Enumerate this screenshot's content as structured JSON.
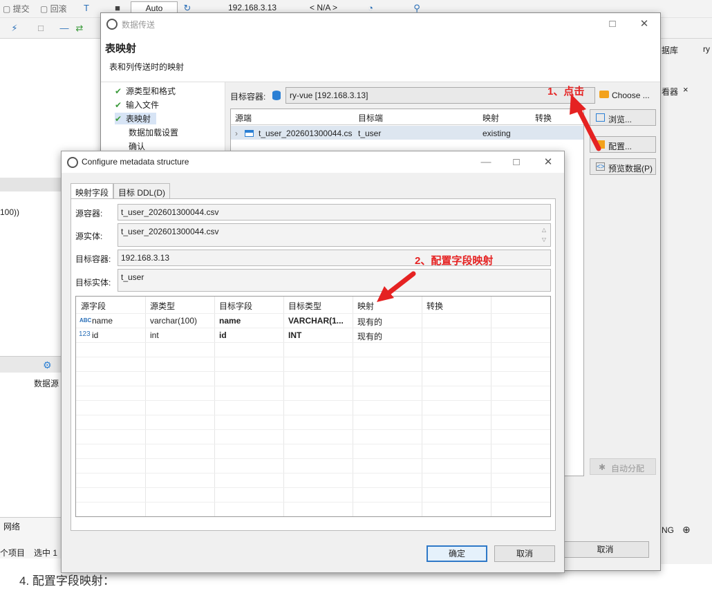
{
  "background": {
    "toolbar": {
      "commit": "提交",
      "rollback": "回滚",
      "mode": "Auto",
      "host": "192.168.3.13",
      "schema": "< N/A >"
    },
    "right_top_label": "据库",
    "right_top_label2": "ry",
    "right_tab": "看器",
    "left_snippet": "100))",
    "left_panel_label": "数据源",
    "bottom_network": "网络",
    "bottom_items": "个项目",
    "bottom_selected": "选中 1",
    "right_status": "NG",
    "note": "4. 配置字段映射："
  },
  "wizard": {
    "title": "数据传送",
    "page_title": "表映射",
    "page_desc": "表和列传送时的映射",
    "steps": [
      {
        "label": "源类型和格式",
        "done": true
      },
      {
        "label": "输入文件",
        "done": true
      },
      {
        "label": "表映射",
        "done": true,
        "active": true
      },
      {
        "label": "数据加载设置",
        "done": false
      },
      {
        "label": "确认",
        "done": false
      }
    ],
    "target_container_label": "目标容器:",
    "target_container_value": "ry-vue  [192.168.3.13]",
    "choose_button": "Choose ...",
    "columns": [
      "源端",
      "目标端",
      "映射",
      "转换"
    ],
    "rows": [
      {
        "source": "t_user_202601300044.cs",
        "target": "t_user",
        "mapping": "existing",
        "transform": ""
      }
    ],
    "browse_button": "浏览...",
    "config_button": "配置...",
    "preview_button": "预览数据(P)",
    "auto_assign_button": "自动分配",
    "cancel_button": "取消"
  },
  "dialog": {
    "title": "Configure metadata structure",
    "tabs": [
      "映射字段",
      "目标 DDL(D)"
    ],
    "source_container_label": "源容器:",
    "source_container_value": "t_user_202601300044.csv",
    "source_entity_label": "源实体:",
    "source_entity_value": "t_user_202601300044.csv",
    "target_container_label": "目标容器:",
    "target_container_value": "192.168.3.13",
    "target_entity_label": "目标实体:",
    "target_entity_value": "t_user",
    "columns": [
      "源字段",
      "源类型",
      "目标字段",
      "目标类型",
      "映射",
      "转换"
    ],
    "rows": [
      {
        "type_badge": "ABC",
        "source_field": "name",
        "source_type": "varchar(100)",
        "target_field": "name",
        "target_type": "VARCHAR(1...",
        "mapping": "现有的",
        "transform": ""
      },
      {
        "type_badge": "123",
        "source_field": "id",
        "source_type": "int",
        "target_field": "id",
        "target_type": "INT",
        "mapping": "现有的",
        "transform": ""
      }
    ],
    "ok_button": "确定",
    "cancel_button": "取消"
  },
  "annotations": {
    "step1": "1、点击",
    "step2": "2、配置字段映射"
  },
  "colors": {
    "annotation_red": "#e52222",
    "accent_blue": "#2e78c7",
    "check_green": "#3c9b3c"
  }
}
